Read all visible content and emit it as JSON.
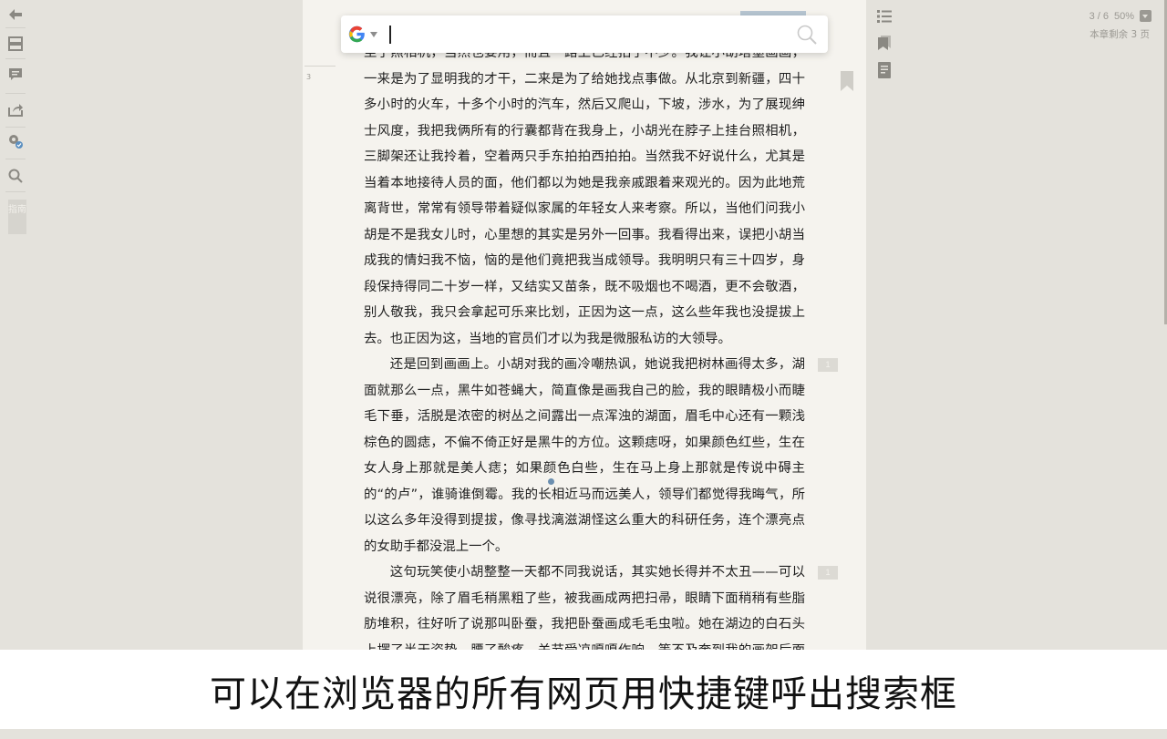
{
  "left_toolbar": {
    "icons": [
      "back-arrow-icon",
      "chapter-list-icon",
      "comments-icon",
      "share-icon",
      "settings-check-icon",
      "search-icon"
    ],
    "guide_label": "指南"
  },
  "right_panel": {
    "icons": [
      "toc-icon",
      "bookmark-icon",
      "notes-book-icon"
    ],
    "page_progress": "3 / 6",
    "zoom": "50%",
    "chapter_remaining": "本章剩余 3 页"
  },
  "reader": {
    "page_number": "3",
    "paragraphs": [
      {
        "indent": false,
        "text": "坐了照相机，当然也要用，而且一路上已经拍了不少。我让小胡塔墨画画，一来是为了显明我的才干，二来是为了给她找点事做。从北京到新疆，四十多小时的火车，十多个小时的汽车，然后又爬山，下坡，涉水，为了展现绅士风度，我把我俩所有的行囊都背在我身上，小胡光在脖子上挂台照相机，三脚架还让我拎着，空着两只手东拍拍西拍拍。当然我不好说什么，尤其是当着本地接待人员的面，他们都以为她是我亲戚跟着来观光的。因为此地荒离背世，常常有领导带着疑似家属的年轻女人来考察。所以，当他们问我小胡是不是我女儿时，心里想的其实是另外一回事。我看得出来，误把小胡当成我的情妇我不恼，恼的是他们竟把我当成领导。我明明只有三十四岁，身段保持得同二十岁一样，又结实又苗条，既不吸烟也不喝酒，更不会敬酒，别人敬我，我只会拿起可乐来比划，正因为这一点，这么些年我也没提拔上去。也正因为这，当地的官员们才以为我是微服私访的大领导。"
      },
      {
        "indent": true,
        "text": "还是回到画画上。小胡对我的画冷嘲热讽，她说我把树林画得太多，湖面就那么一点，黑牛如苍蝇大，简直像是画我自己的脸，我的眼睛极小而睫毛下垂，活脱是浓密的树丛之间露出一点浑浊的湖面，眉毛中心还有一颗浅棕色的圆痣，不偏不倚正好是黑牛的方位。这颗痣呀，如果颜色红些，生在女人身上那就是美人痣；如果颜色白些，生在马上身上那就是传说中碍主的“的卢”，谁骑谁倒霉。我的长相近马而远美人，领导们都觉得我晦气，所以这么多年没得到提拔，像寻找漓滋湖怪这么重大的科研任务，连个漂亮点的女助手都没混上一个。"
      },
      {
        "indent": true,
        "text": "这句玩笑使小胡整整一天都不同我说话，其实她长得并不太丑——可以说很漂亮，除了眉毛稍黑粗了些，被我画成两把扫帚，眼睛下面稍稍有些脂肪堆积，往好听了说那叫卧蚕，我把卧蚕画成毛毛虫啦。她在湖边的白石头上摆了半天姿势，腰了酸疼，关节受凉嘎嘎作响，等不及奔到我的画架后面一看，张"
      }
    ],
    "annotation_counts": [
      "1",
      "1"
    ]
  },
  "search_overlay": {
    "engine_icon": "google-logo-icon",
    "placeholder": "",
    "value": ""
  },
  "caption": "可以在浏览器的所有网页用快捷键呼出搜索框"
}
